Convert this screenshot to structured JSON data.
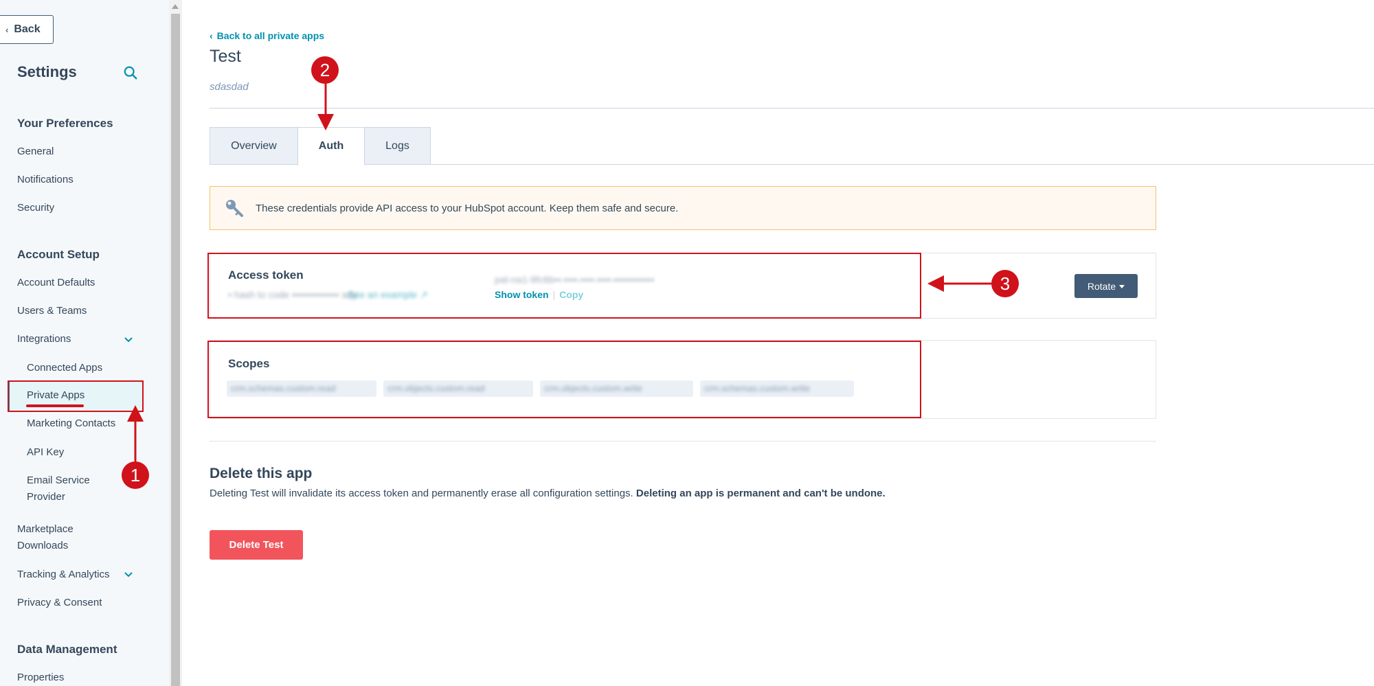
{
  "sidebar": {
    "back_label": "Back",
    "title": "Settings",
    "sections": {
      "preferences": "Your Preferences",
      "account_setup": "Account Setup",
      "data_management": "Data Management"
    },
    "items": {
      "general": "General",
      "notifications": "Notifications",
      "security": "Security",
      "account_defaults": "Account Defaults",
      "users_teams": "Users & Teams",
      "integrations": "Integrations",
      "connected_apps": "Connected Apps",
      "private_apps": "Private Apps",
      "marketing_contacts": "Marketing Contacts",
      "api_key": "API Key",
      "email_service_1": "Email Service",
      "email_service_2": "Provider",
      "marketplace_1": "Marketplace",
      "marketplace_2": "Downloads",
      "tracking_analytics": "Tracking & Analytics",
      "privacy_consent": "Privacy & Consent",
      "properties": "Properties"
    },
    "active_item": "Private Apps"
  },
  "header": {
    "back_link": "Back to all private apps",
    "app_name": "Test",
    "app_description": "sdasdad"
  },
  "tabs": [
    {
      "label": "Overview",
      "active": false
    },
    {
      "label": "Auth",
      "active": true
    },
    {
      "label": "Logs",
      "active": false
    }
  ],
  "alert": {
    "icon": "key-icon",
    "text": "These credentials provide API access to your HubSpot account. Keep them safe and secure."
  },
  "access_token": {
    "label": "Access token",
    "show_token_label": "Show token",
    "copy_label": "Copy",
    "rotate_label": "Rotate"
  },
  "scopes": {
    "label": "Scopes"
  },
  "delete_section": {
    "title": "Delete this app",
    "description": "Deleting Test will invalidate its access token and permanently erase all configuration settings.",
    "warning": "Deleting an app is permanent and can't be undone.",
    "button_label": "Delete Test"
  },
  "annotations": {
    "step1": "1",
    "step2": "2",
    "step3": "3"
  },
  "colors": {
    "accent": "#0091ae",
    "annotation_red": "#d0121b",
    "delete_button": "#f2545b",
    "rotate_button": "#425b76",
    "sidebar_bg": "#f5f8fa"
  }
}
